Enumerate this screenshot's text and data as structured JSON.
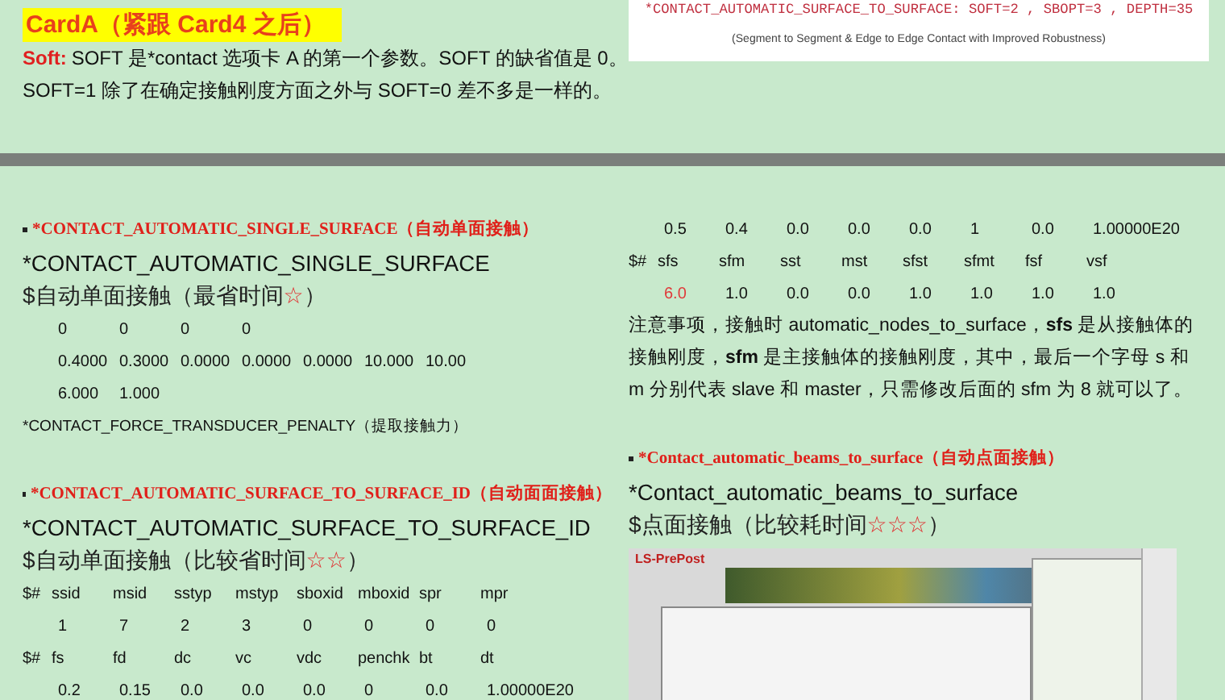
{
  "top_page": {
    "heading": "CardA（紧跟 Card4 之后）",
    "soft_label": "Soft:",
    "soft_text": "SOFT 是*contact 选项卡 A 的第一个参数。SOFT 的缺省值是 0。",
    "soft_text_2": "SOFT=1 除了在确定接触刚度方面之外与 SOFT=0 差不多是一样的。",
    "code_box": {
      "code": "*CONTACT_AUTOMATIC_SURFACE_TO_SURFACE: SOFT=2 , SBOPT=3 , DEPTH=35",
      "caption": "(Segment to Segment & Edge to Edge Contact with Improved Robustness)"
    }
  },
  "columns": [
    {
      "blocks": [
        {
          "kind": "section",
          "heading": "*CONTACT_AUTOMATIC_SINGLE_SURFACE（自动单面接触）",
          "keyword": "*CONTACT_AUTOMATIC_SINGLE_SURFACE",
          "comment": "$自动单面接触（最省时间",
          "comment_stars": "☆",
          "comment_end": "）"
        },
        {
          "kind": "row",
          "cells": [
            "0",
            "0",
            "0",
            "0"
          ]
        },
        {
          "kind": "row",
          "cells": [
            "0.4000",
            "0.3000",
            "0.0000",
            "0.0000",
            "0.0000",
            "10.000",
            "10.00"
          ]
        },
        {
          "kind": "row",
          "cells": [
            "6.000",
            "1.000"
          ]
        },
        {
          "kind": "note",
          "text": "*CONTACT_FORCE_TRANSDUCER_PENALTY（提取接触力）"
        },
        {
          "kind": "blank"
        },
        {
          "kind": "section",
          "heading": "*CONTACT_AUTOMATIC_SURFACE_TO_SURFACE_ID（自动面面接触）",
          "keyword": "*CONTACT_AUTOMATIC_SURFACE_TO_SURFACE_ID",
          "comment": "$自动单面接触（比较省时间",
          "comment_stars": "☆☆",
          "comment_end": "）"
        },
        {
          "kind": "header",
          "lead": "$#",
          "cells": [
            "ssid",
            "msid",
            "sstyp",
            "mstyp",
            "sboxid",
            "mboxid",
            "spr",
            "mpr"
          ]
        },
        {
          "kind": "row",
          "cells": [
            "1",
            "7",
            "2",
            "3",
            "0",
            "0",
            "0",
            "0"
          ]
        },
        {
          "kind": "header",
          "lead": "$#",
          "cells": [
            "fs",
            "fd",
            "dc",
            "vc",
            "vdc",
            "penchk",
            "bt",
            "dt"
          ]
        },
        {
          "kind": "row",
          "cells": [
            "0.2",
            "0.15",
            "0.0",
            "0.0",
            "0.0",
            "0",
            "0.0",
            "1.00000E20"
          ]
        }
      ]
    },
    {
      "blocks": [
        {
          "kind": "row",
          "cells": [
            "0.5",
            "0.4",
            "0.0",
            "0.0",
            "0.0",
            "1",
            "0.0",
            "1.00000E20"
          ]
        },
        {
          "kind": "header",
          "lead": "$#",
          "cells": [
            "sfs",
            "sfm",
            "sst",
            "mst",
            "sfst",
            "sfmt",
            "fsf",
            "vsf"
          ]
        },
        {
          "kind": "row",
          "cells": [
            {
              "text": "6.0",
              "changed": true
            },
            {
              "text": "1.0",
              "changed": false
            },
            {
              "text": "0.0",
              "changed": false
            },
            {
              "text": "0.0",
              "changed": false
            },
            {
              "text": "1.0",
              "changed": false
            },
            {
              "text": "1.0",
              "changed": false
            },
            {
              "text": "1.0",
              "changed": false
            },
            {
              "text": "1.0",
              "changed": false
            }
          ]
        },
        {
          "kind": "paragraph",
          "text": "注意事项，接触时 automatic_nodes_to_surface，**sfs** 是从接触体的接触刚度，**sfm** 是主接触体的接触刚度，其中，最后一个字母 s 和 m 分别代表 slave 和 master，只需修改后面的 sfm 为 8 就可以了。"
        },
        {
          "kind": "blank"
        },
        {
          "kind": "section",
          "heading": "*Contact_automatic_beams_to_surface（自动点面接触）",
          "keyword": "*Contact_automatic_beams_to_surface",
          "comment": "$点面接触（比较耗时间",
          "comment_stars": "☆☆☆",
          "comment_end": "）"
        },
        {
          "kind": "screenshot",
          "title": "LS-PrePost"
        }
      ]
    }
  ]
}
